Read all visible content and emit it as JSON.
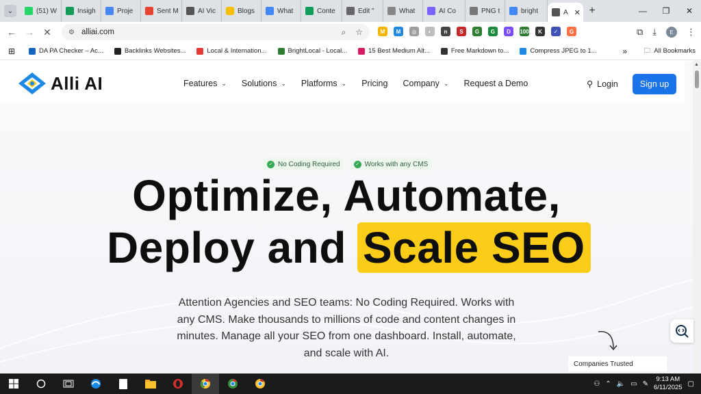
{
  "browser": {
    "tabs": [
      {
        "label": "(51) W",
        "icon": "whatsapp-icon",
        "color": "#25d366"
      },
      {
        "label": "Insigh",
        "icon": "sheets-icon",
        "color": "#0f9d58"
      },
      {
        "label": "Proje",
        "icon": "docs-icon",
        "color": "#4285f4"
      },
      {
        "label": "Sent M",
        "icon": "gmail-icon",
        "color": "#ea4335"
      },
      {
        "label": "AI Vic",
        "icon": "link-icon",
        "color": "#555555"
      },
      {
        "label": "Blogs",
        "icon": "drive-icon",
        "color": "#fbbc04"
      },
      {
        "label": "What",
        "icon": "docs-icon",
        "color": "#4285f4"
      },
      {
        "label": "Conte",
        "icon": "sheets-icon",
        "color": "#0f9d58"
      },
      {
        "label": "Edit \"",
        "icon": "globe-icon",
        "color": "#666666"
      },
      {
        "label": "What",
        "icon": "dash-icon",
        "color": "#888888"
      },
      {
        "label": "AI Co",
        "icon": "sparkle-icon",
        "color": "#7b61ff"
      },
      {
        "label": "PNG t",
        "icon": "cloud-icon",
        "color": "#777777"
      },
      {
        "label": "bright",
        "icon": "google-icon",
        "color": "#4285f4"
      },
      {
        "label": "A",
        "icon": "allai-icon",
        "color": "#555555"
      }
    ],
    "new_tab": "+",
    "window_controls": {
      "minimize": "—",
      "restore": "❐",
      "close": "✕"
    },
    "url": "alliai.com",
    "extensions": [
      {
        "label": "M",
        "color": "#f4b400"
      },
      {
        "label": "M",
        "color": "#1e88e5"
      },
      {
        "label": "◎",
        "color": "#9e9e9e"
      },
      {
        "label": "◐",
        "color": "#bdbdbd"
      },
      {
        "label": "n",
        "color": "#444444"
      },
      {
        "label": "S",
        "color": "#c62828"
      },
      {
        "label": "G",
        "color": "#2e7d32"
      },
      {
        "label": "G",
        "color": "#1b8a3a"
      },
      {
        "label": "D",
        "color": "#7c4dff"
      },
      {
        "label": "100",
        "color": "#2e7d32"
      },
      {
        "label": "K",
        "color": "#333333"
      },
      {
        "label": "✓",
        "color": "#3f51b5"
      },
      {
        "label": "G",
        "color": "#ff7043"
      }
    ],
    "profile_initial": "E",
    "bookmarks": [
      {
        "label": "DA PA Checker – Ac...",
        "color": "#1565c0"
      },
      {
        "label": "Backlinks Websites...",
        "color": "#222222"
      },
      {
        "label": "Local & Internation...",
        "color": "#e53935"
      },
      {
        "label": "BrightLocal - Local...",
        "color": "#2e7d32"
      },
      {
        "label": "15 Best Medium Alt...",
        "color": "#d81b60"
      },
      {
        "label": "Free Markdown to...",
        "color": "#333333"
      },
      {
        "label": "Compress JPEG to 1...",
        "color": "#1e88e5"
      }
    ],
    "all_bookmarks": "All Bookmarks"
  },
  "site": {
    "brand": "Alli AI",
    "nav": [
      {
        "label": "Features",
        "dropdown": true
      },
      {
        "label": "Solutions",
        "dropdown": true
      },
      {
        "label": "Platforms",
        "dropdown": true
      },
      {
        "label": "Pricing",
        "dropdown": false
      },
      {
        "label": "Company",
        "dropdown": true
      },
      {
        "label": "Request a Demo",
        "dropdown": false
      }
    ],
    "login": "Login",
    "signup": "Sign up",
    "badges": [
      "No Coding Required",
      "Works with any CMS"
    ],
    "headline_line1": "Optimize, Automate,",
    "headline_line2_plain": "Deploy and",
    "headline_line2_highlight": "Scale SEO",
    "description": "Attention Agencies and SEO teams: No Coding Required. Works with any CMS. Make thousands to millions of code and content changes in minutes. Manage all your SEO from one dashboard. Install, automate, and scale with AI.",
    "companies_trusted": "Companies Trusted",
    "accent_color": "#1a73e8",
    "highlight_color": "#fbcd19"
  },
  "taskbar": {
    "time": "9:13 AM",
    "date": "6/11/2025"
  }
}
